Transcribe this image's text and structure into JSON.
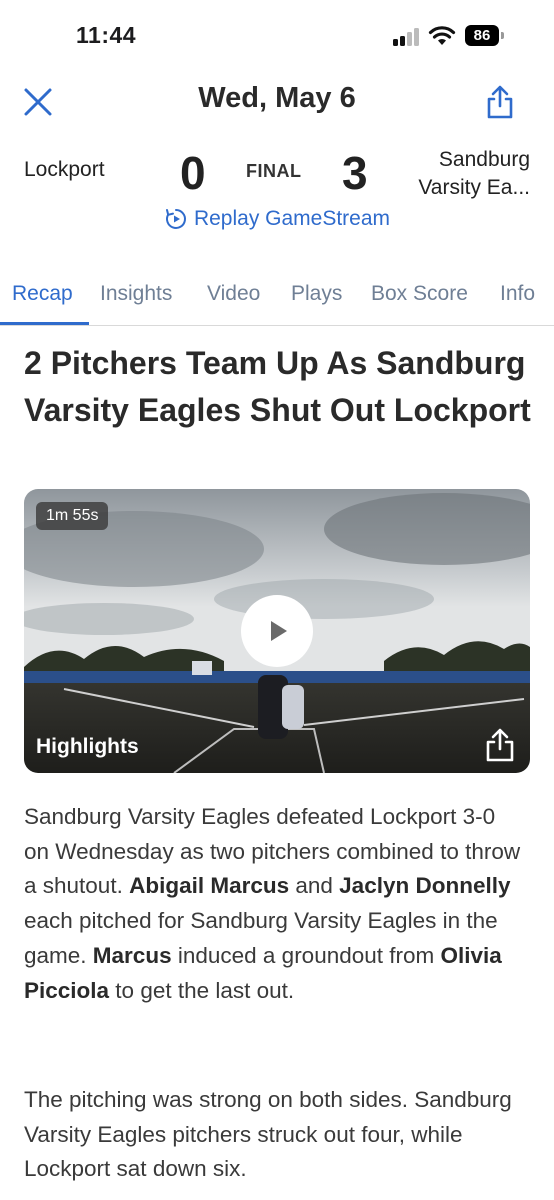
{
  "status": {
    "time": "11:44",
    "battery": "86"
  },
  "header": {
    "date": "Wed, May 6",
    "close_icon": "close-icon",
    "share_icon": "share-icon"
  },
  "score": {
    "home_team": "Lockport",
    "home_score": "0",
    "status": "FINAL",
    "away_score": "3",
    "away_team": "Sandburg\nVarsity Ea...",
    "replay_label": "Replay GameStream"
  },
  "tabs": [
    {
      "label": "Recap",
      "active": true
    },
    {
      "label": "Insights"
    },
    {
      "label": "Video"
    },
    {
      "label": "Plays"
    },
    {
      "label": "Box Score"
    },
    {
      "label": "Info"
    }
  ],
  "article": {
    "headline": "2 Pitchers Team Up As Sandburg Varsity Eagles Shut Out Lockport",
    "video": {
      "duration": "1m 55s",
      "label": "Highlights"
    },
    "p1": {
      "t1": "Sandburg Varsity Eagles defeated Lockport 3-0 on Wednesday as two pitchers combined to throw a shutout. ",
      "b1": "Abigail Marcus",
      "t2": " and ",
      "b2": "Jaclyn Donnelly",
      "t3": " each pitched for Sandburg Varsity Eagles in the game. ",
      "b3": "Marcus",
      "t4": " induced a groundout from ",
      "b4": "Olivia Picciola",
      "t5": " to get the last out."
    },
    "p2": "The pitching was strong on both sides. Sandburg Varsity Eagles pitchers struck out four, while Lockport sat down six."
  },
  "colors": {
    "accent": "#2f6bcc",
    "tab_inactive": "#6f7f95"
  }
}
